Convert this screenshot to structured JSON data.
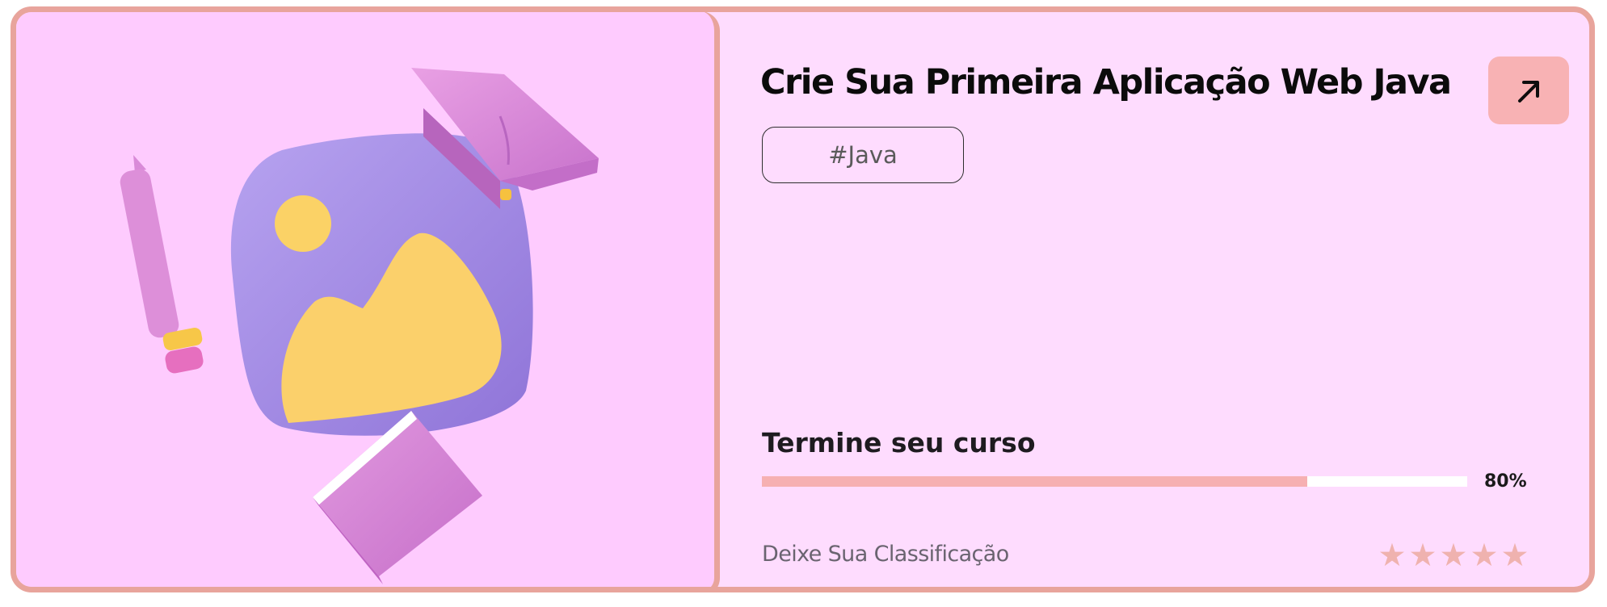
{
  "course": {
    "title": "Crie Sua Primeira Aplicação Web Java",
    "tag": "#Java",
    "open_icon": "arrow-up-right-icon",
    "illustration_icon": "image-graduation-illustration"
  },
  "progress": {
    "label": "Termine seu curso",
    "value_text": "80%",
    "fraction": 0.773
  },
  "rating": {
    "label": "Deixe Sua Classificação",
    "stars": [
      "★",
      "★",
      "★",
      "★",
      "★"
    ],
    "max": 5
  },
  "colors": {
    "border": "#e8a49c",
    "card_background": "#fedcfe",
    "image_background": "#fecbfe",
    "accent": "#f6b0b2",
    "star": "#efb2af"
  }
}
